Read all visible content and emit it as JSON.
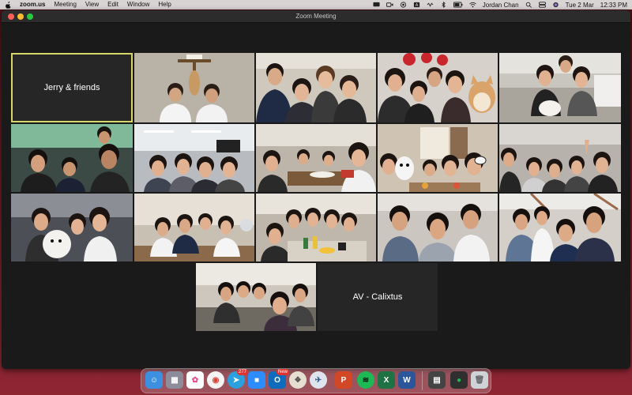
{
  "menubar": {
    "app_name": "zoom.us",
    "menus": [
      "Meeting",
      "View",
      "Edit",
      "Window",
      "Help"
    ],
    "user_name": "Jordan Chan",
    "date": "Tue 2 Mar",
    "time": "12:33 PM"
  },
  "window": {
    "title": "Zoom Meeting"
  },
  "participants": {
    "name_tile_1": "Jerry & friends",
    "name_tile_2": "AV - Calixtus"
  },
  "dock": {
    "badge_telegram": "277",
    "badge_outlook": "New"
  },
  "colors": {
    "active_speaker_border": "#d6d66a",
    "tile_background": "#262626",
    "window_background": "#1a1a1a"
  }
}
